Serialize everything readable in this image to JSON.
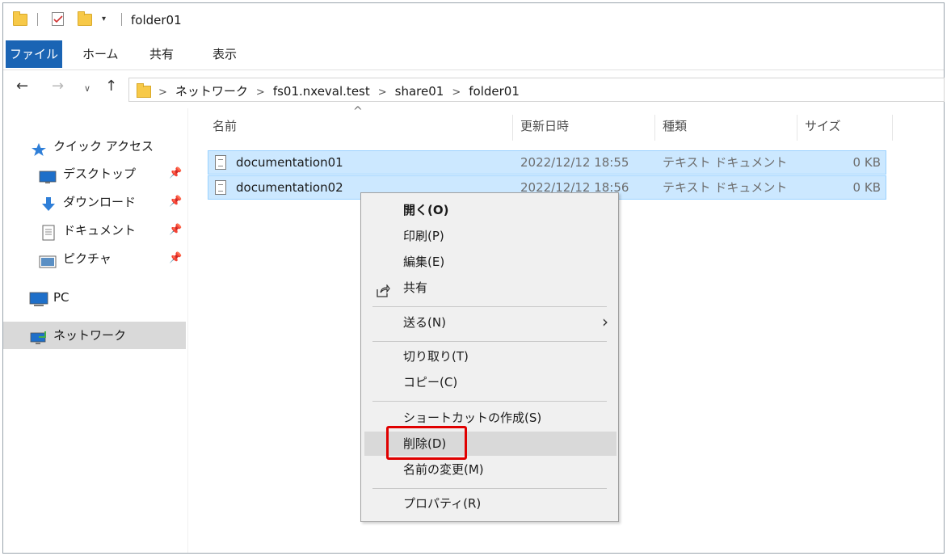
{
  "window": {
    "title": "folder01"
  },
  "ribbon": {
    "tabs": [
      "ファイル",
      "ホーム",
      "共有",
      "表示"
    ]
  },
  "address": {
    "crumbs": [
      "ネットワーク",
      "fs01.nxeval.test",
      "share01",
      "folder01"
    ]
  },
  "sidebar": {
    "quick_access": "クイック アクセス",
    "items": [
      {
        "label": "デスクトップ",
        "icon": "desktop-icon"
      },
      {
        "label": "ダウンロード",
        "icon": "download-icon"
      },
      {
        "label": "ドキュメント",
        "icon": "documents-icon"
      },
      {
        "label": "ピクチャ",
        "icon": "pictures-icon"
      }
    ],
    "pc": "PC",
    "network": "ネットワーク"
  },
  "columns": {
    "name": "名前",
    "date": "更新日時",
    "type": "種類",
    "size": "サイズ"
  },
  "files": [
    {
      "name": "documentation01",
      "date": "2022/12/12 18:55",
      "type": "テキスト ドキュメント",
      "size": "0 KB"
    },
    {
      "name": "documentation02",
      "date": "2022/12/12 18:56",
      "type": "テキスト ドキュメント",
      "size": "0 KB"
    }
  ],
  "context_menu": {
    "open": "開く(O)",
    "print": "印刷(P)",
    "edit": "編集(E)",
    "share": "共有",
    "send_to": "送る(N)",
    "cut": "切り取り(T)",
    "copy": "コピー(C)",
    "create_shortcut": "ショートカットの作成(S)",
    "delete": "削除(D)",
    "rename": "名前の変更(M)",
    "properties": "プロパティ(R)"
  },
  "colors": {
    "file_tab": "#1a64b4",
    "selection": "#cce8ff",
    "highlight": "#e00000"
  }
}
